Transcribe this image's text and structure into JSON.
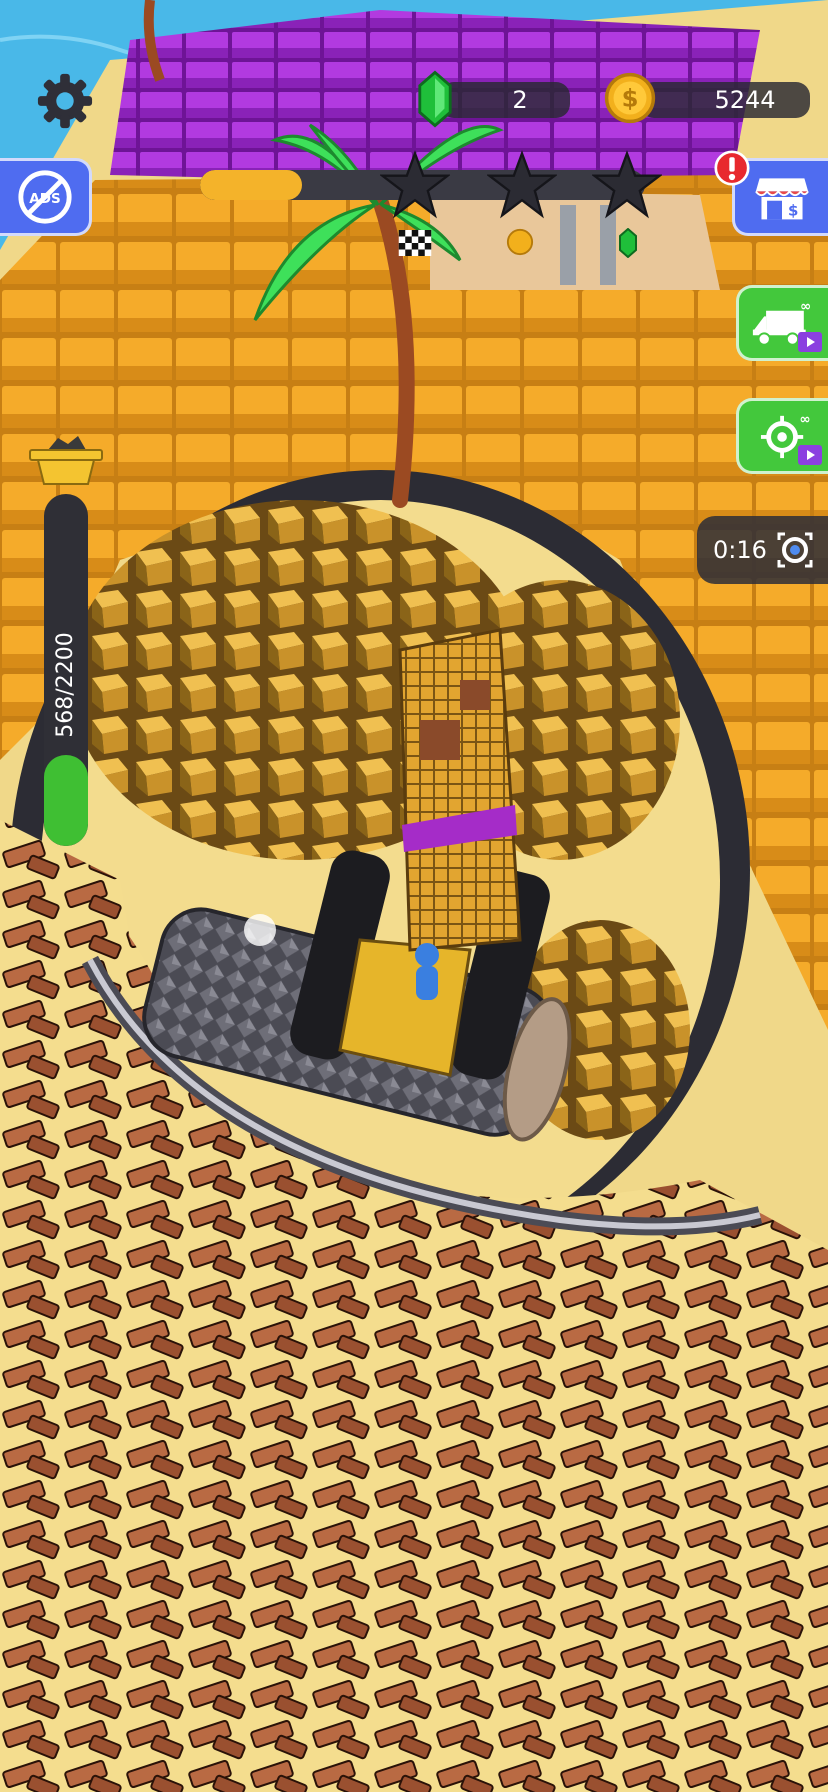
{
  "hud": {
    "gems_count": "2",
    "coins_count": "5244",
    "timer": "0:16",
    "capacity_text": "568/2200",
    "capacity_fraction": 0.258,
    "level_progress_fraction": 0.23,
    "stars_earned": 0,
    "stars_total": 3,
    "no_ads_label": "ADS"
  },
  "colors": {
    "gem_green": "#1fbf3a",
    "coin_gold": "#f2b01c",
    "progress_fill": "#f4b32a",
    "capacity_fill": "#3fbf33",
    "button_blue": "#4f6cf0",
    "button_green": "#43c83c",
    "purple_blocks": "#a42fd4",
    "gold_blocks": "#f2a927",
    "copper_bars": "#b8683e",
    "sand": "#f3dc8e"
  },
  "icons": [
    "gear-icon",
    "gem-icon",
    "coin-icon",
    "no-ads-icon",
    "shop-icon",
    "truck-icon",
    "target-icon",
    "video-icon",
    "star-icon",
    "finish-flag-icon",
    "infinity-icon",
    "alert-icon"
  ]
}
